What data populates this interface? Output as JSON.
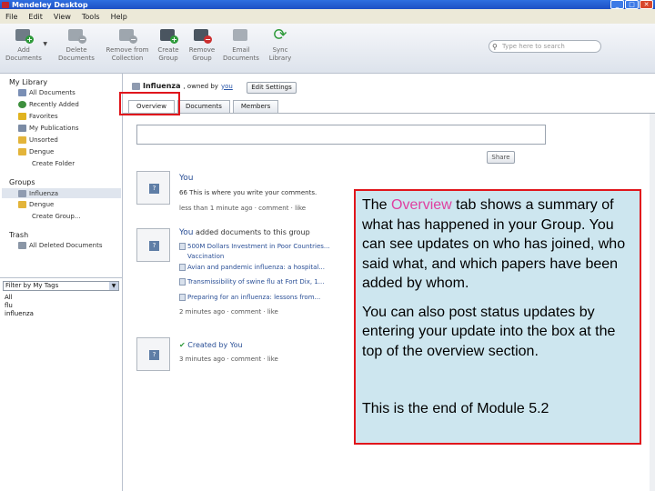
{
  "window": {
    "title": "Mendeley Desktop",
    "controls": [
      "_",
      "□",
      "✕"
    ]
  },
  "menubar": {
    "items": [
      "File",
      "Edit",
      "View",
      "Tools",
      "Help"
    ]
  },
  "toolbar": {
    "buttons": [
      {
        "label": "Add\nDocuments",
        "icon": "add-documents-icon"
      },
      {
        "label": "Delete\nDocuments",
        "icon": "delete-documents-icon"
      },
      {
        "label": "Remove from\nCollection",
        "icon": "remove-from-collection-icon"
      },
      {
        "label": "Create\nGroup",
        "icon": "create-group-icon"
      },
      {
        "label": "Remove\nGroup",
        "icon": "remove-group-icon"
      },
      {
        "label": "Email\nDocuments",
        "icon": "email-documents-icon"
      },
      {
        "label": "Sync\nLibrary",
        "icon": "sync-library-icon"
      }
    ],
    "search_placeholder": "Type here to search"
  },
  "sidebar": {
    "my_library_heading": "My Library",
    "library_items": [
      "All Documents",
      "Recently Added",
      "Favorites",
      "My Publications",
      "Unsorted",
      "Dengue",
      "Create Folder"
    ],
    "groups_heading": "Groups",
    "group_items": [
      "Influenza",
      "Dengue",
      "Create Group..."
    ],
    "trash_heading": "Trash",
    "trash_items": [
      "All Deleted Documents"
    ],
    "filter_label": "Filter by My Tags",
    "tags": [
      "All",
      "flu",
      "influenza"
    ]
  },
  "main": {
    "group_name": "Influenza",
    "owned_by": ", owned by",
    "owner": "you",
    "edit_settings": "Edit Settings",
    "tabs": [
      "Overview",
      "Documents",
      "Members"
    ],
    "share_label": "Share",
    "feed": [
      {
        "who": "You",
        "lines": [
          "66 This is where you write your comments."
        ],
        "meta": "less than 1 minute ago · comment · like"
      },
      {
        "who": "You",
        "who_rest": " added documents to this group",
        "lines": [
          "500M Dollars Investment in Poor Countries...",
          "Vaccination",
          "Avian and pandemic influenza: a hospital...",
          "Transmissibility of swine flu at Fort Dix, 1...",
          "Preparing for an influenza: lessons from..."
        ],
        "meta": "2 minutes ago · comment · like"
      },
      {
        "who": "Created by You",
        "lines": [],
        "meta": "3 minutes ago · comment · like"
      }
    ]
  },
  "callout": {
    "p1_before": "The ",
    "p1_accent": "Overview",
    "p1_after": " tab shows a summary of what has happened in your Group. You can see updates on who has joined, who said what, and which papers have been added by whom.",
    "p2": "You can also post status updates by entering your update into the box at the top of the overview section.",
    "p3": "This is the end of Module 5.2",
    "accent_color": "#e03fa0",
    "border_color": "#e0161c",
    "background_color": "#cde6ef"
  }
}
